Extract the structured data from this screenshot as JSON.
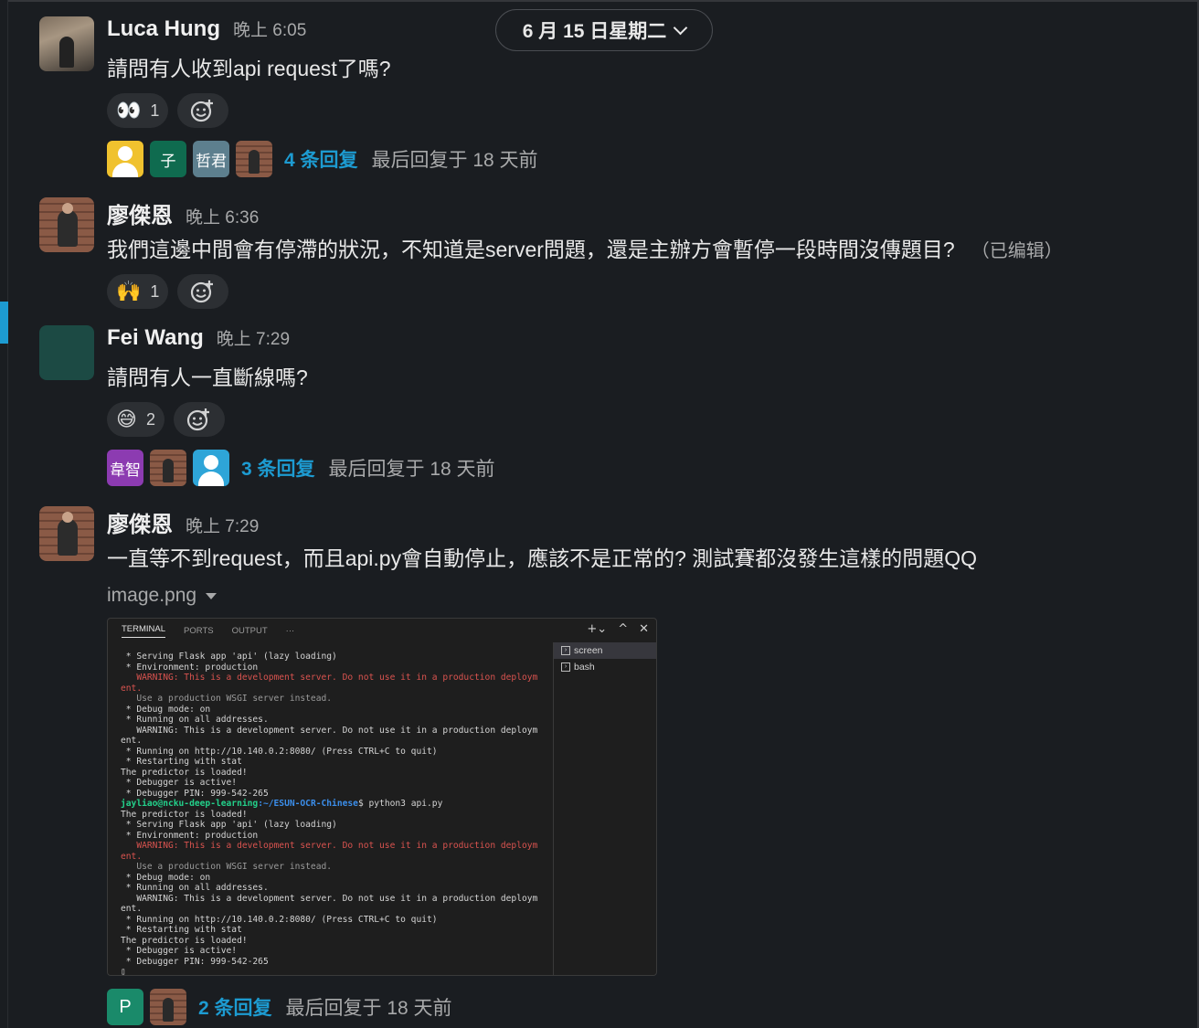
{
  "date_pill": {
    "label": "6 月 15 日星期二"
  },
  "messages": [
    {
      "name": "Luca Hung",
      "time": "晚上 6:05",
      "text": "請問有人收到api request了嗎?",
      "reactions": [
        {
          "emoji": "👀",
          "count": "1"
        }
      ],
      "thread": {
        "avatars": [
          "",
          "子",
          "哲君",
          ""
        ],
        "replies": "4 条回复",
        "last": "最后回复于 18 天前"
      }
    },
    {
      "name": "廖傑恩",
      "time": "晚上 6:36",
      "text": "我們這邊中間會有停滯的狀況，不知道是server問題，還是主辦方會暫停一段時間沒傳題目?",
      "edited": "（已编辑）",
      "reactions": [
        {
          "emoji": "🙌",
          "count": "1"
        }
      ]
    },
    {
      "name": "Fei Wang",
      "time": "晚上 7:29",
      "text": "請問有人一直斷線嗎?",
      "reactions": [
        {
          "emoji": "😅",
          "count": "2"
        }
      ],
      "thread": {
        "avatars": [
          "韋智",
          "",
          ""
        ],
        "replies": "3 条回复",
        "last": "最后回复于 18 天前"
      }
    },
    {
      "name": "廖傑恩",
      "time": "晚上 7:29",
      "text": "一直等不到request，而且api.py會自動停止，應該不是正常的? 測試賽都沒發生這樣的問題QQ",
      "file": "image.png",
      "thread": {
        "avatars": [
          "P",
          ""
        ],
        "replies": "2 条回复",
        "last": "最后回复于 18 天前"
      }
    }
  ],
  "terminal": {
    "tabs": [
      "TERMINAL",
      "PORTS",
      "OUTPUT",
      "···"
    ],
    "controls": [
      "+⌄",
      "^",
      "✕"
    ],
    "sessions": [
      "screen",
      "bash"
    ],
    "lines": [
      {
        "t": " * Serving Flask app 'api' (lazy loading)",
        "c": ""
      },
      {
        "t": " * Environment: production",
        "c": ""
      },
      {
        "t": "   WARNING: This is a development server. Do not use it in a production deploym",
        "c": "red"
      },
      {
        "t": "ent.",
        "c": "red"
      },
      {
        "t": "   Use a production WSGI server instead.",
        "c": "dim"
      },
      {
        "t": " * Debug mode: on",
        "c": ""
      },
      {
        "t": " * Running on all addresses.",
        "c": ""
      },
      {
        "t": "   WARNING: This is a development server. Do not use it in a production deploym",
        "c": ""
      },
      {
        "t": "ent.",
        "c": ""
      },
      {
        "t": " * Running on http://10.140.0.2:8080/ (Press CTRL+C to quit)",
        "c": ""
      },
      {
        "t": " * Restarting with stat",
        "c": ""
      },
      {
        "t": "The predictor is loaded!",
        "c": ""
      },
      {
        "t": " * Debugger is active!",
        "c": ""
      },
      {
        "t": " * Debugger PIN: 999-542-265",
        "c": ""
      },
      {
        "t": "PROMPT",
        "c": "prompt"
      },
      {
        "t": "The predictor is loaded!",
        "c": ""
      },
      {
        "t": " * Serving Flask app 'api' (lazy loading)",
        "c": ""
      },
      {
        "t": " * Environment: production",
        "c": ""
      },
      {
        "t": "   WARNING: This is a development server. Do not use it in a production deploym",
        "c": "red"
      },
      {
        "t": "ent.",
        "c": "red"
      },
      {
        "t": "   Use a production WSGI server instead.",
        "c": "dim"
      },
      {
        "t": " * Debug mode: on",
        "c": ""
      },
      {
        "t": " * Running on all addresses.",
        "c": ""
      },
      {
        "t": "   WARNING: This is a development server. Do not use it in a production deploym",
        "c": ""
      },
      {
        "t": "ent.",
        "c": ""
      },
      {
        "t": " * Running on http://10.140.0.2:8080/ (Press CTRL+C to quit)",
        "c": ""
      },
      {
        "t": " * Restarting with stat",
        "c": ""
      },
      {
        "t": "The predictor is loaded!",
        "c": ""
      },
      {
        "t": " * Debugger is active!",
        "c": ""
      },
      {
        "t": " * Debugger PIN: 999-542-265",
        "c": ""
      },
      {
        "t": "▯",
        "c": ""
      }
    ],
    "prompt_user": "jayliao@ncku-deep-learning",
    "prompt_path": ":~/ESUN-OCR-Chinese",
    "prompt_cmd": "$ python3 api.py"
  }
}
